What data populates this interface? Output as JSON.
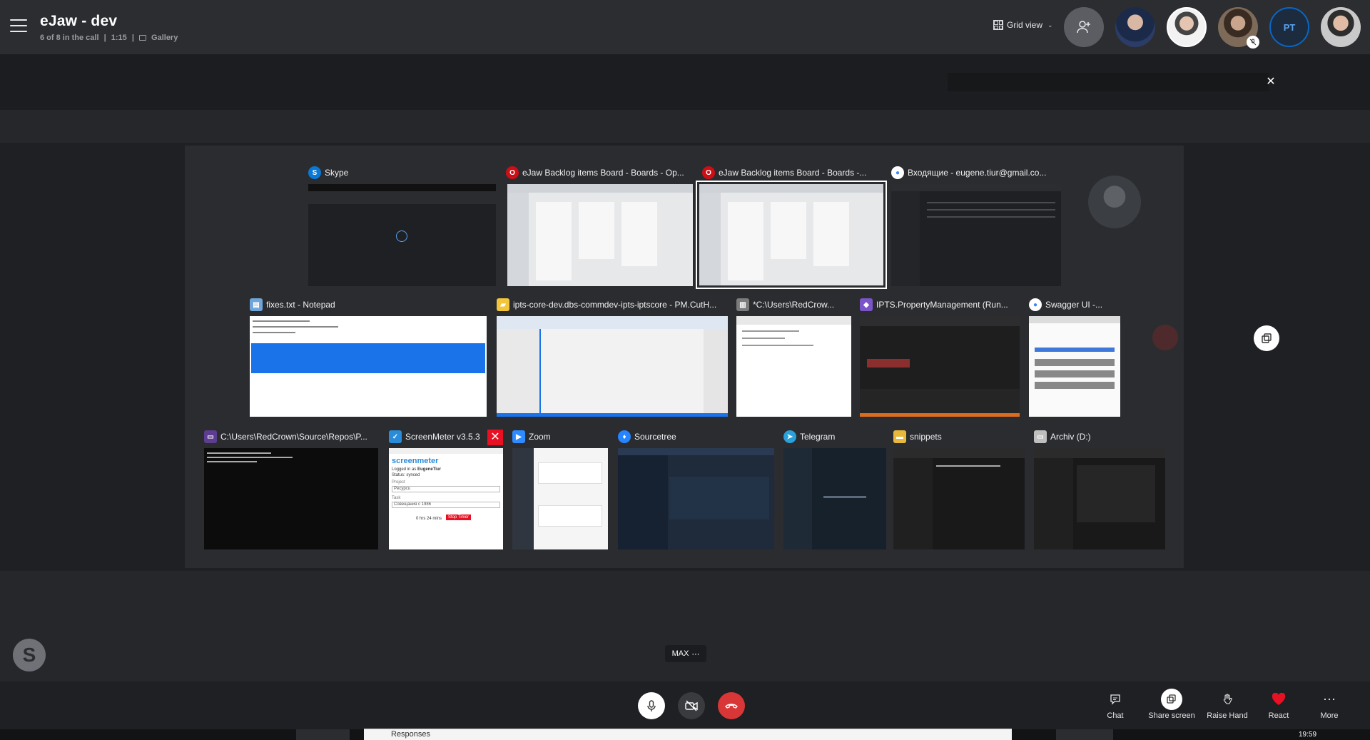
{
  "header": {
    "title": "eJaw - dev",
    "participants_status": "6 of 8 in the call",
    "duration": "1:15",
    "separator": "|",
    "view_mode": "Gallery",
    "grid_view_label": "Grid view",
    "participant_initials": "PT"
  },
  "windows": [
    {
      "name": "skype",
      "title": "Skype",
      "icon_color": "#0a78d4",
      "icon_glyph": "S"
    },
    {
      "name": "opera-backlog-1",
      "title": "eJaw Backlog items Board - Boards - Op...",
      "icon_color": "#cc0f16",
      "icon_glyph": "O"
    },
    {
      "name": "opera-backlog-2",
      "title": "eJaw Backlog items Board - Boards -...",
      "icon_color": "#cc0f16",
      "icon_glyph": "O"
    },
    {
      "name": "gmail-inbox",
      "title": "Входящие - eugene.tiur@gmail.co...",
      "icon_color": "#4285f4",
      "icon_glyph": "●"
    },
    {
      "name": "notepad",
      "title": "fixes.txt - Notepad",
      "icon_color": "#6fa5d8",
      "icon_glyph": "▤"
    },
    {
      "name": "ipts-core",
      "title": "ipts-core-dev.dbs-commdev-ipts-iptscore - PM.CutH...",
      "icon_color": "#f3c53b",
      "icon_glyph": "▰"
    },
    {
      "name": "redcrow-editor",
      "title": "*C:\\Users\\RedCrow...",
      "icon_color": "#7c7c7c",
      "icon_glyph": "▥"
    },
    {
      "name": "ipts-vs",
      "title": "IPTS.PropertyManagement (Run...",
      "icon_color": "#7b54c8",
      "icon_glyph": "◆"
    },
    {
      "name": "swagger",
      "title": "Swagger UI -...",
      "icon_color": "#4285f4",
      "icon_glyph": "●"
    },
    {
      "name": "console",
      "title": "C:\\Users\\RedCrown\\Source\\Repos\\P...",
      "icon_color": "#5c3d8f",
      "icon_glyph": "▭"
    },
    {
      "name": "screenmeter",
      "title": "ScreenMeter v3.5.3",
      "icon_color": "#2a8bd8",
      "icon_glyph": "✓"
    },
    {
      "name": "zoom",
      "title": "Zoom",
      "icon_color": "#2d8cff",
      "icon_glyph": "▶"
    },
    {
      "name": "sourcetree",
      "title": "Sourcetree",
      "icon_color": "#2684ff",
      "icon_glyph": "♦"
    },
    {
      "name": "telegram",
      "title": "Telegram",
      "icon_color": "#2aa1da",
      "icon_glyph": "➤"
    },
    {
      "name": "snippets",
      "title": "snippets",
      "icon_color": "#e8b83a",
      "icon_glyph": "▬"
    },
    {
      "name": "archiv",
      "title": "Archiv (D:)",
      "icon_color": "#bfbfbf",
      "icon_glyph": "▭"
    }
  ],
  "screenmeter": {
    "logged_in_as": "Logged in as",
    "user": "EugeneTiur",
    "status": "Status: synced",
    "project_label": "Project",
    "project_value": "Pecypcu",
    "task_label": "Task",
    "task_value": "Cовещания c 1986",
    "elapsed": "0 hrs 24 mins",
    "stop_button": "Stop Timer",
    "brand": "screenmeter"
  },
  "stage": {
    "max_label": "MAX"
  },
  "controls": {
    "chat": "Chat",
    "share_screen": "Share screen",
    "raise_hand": "Raise Hand",
    "react": "React",
    "more": "More"
  },
  "taskbar": {
    "responses_tab": "Responses",
    "clock": "19:59"
  },
  "colors": {
    "accent": "#0a66c2",
    "end_call": "#d93737",
    "react_heart": "#e81123"
  }
}
